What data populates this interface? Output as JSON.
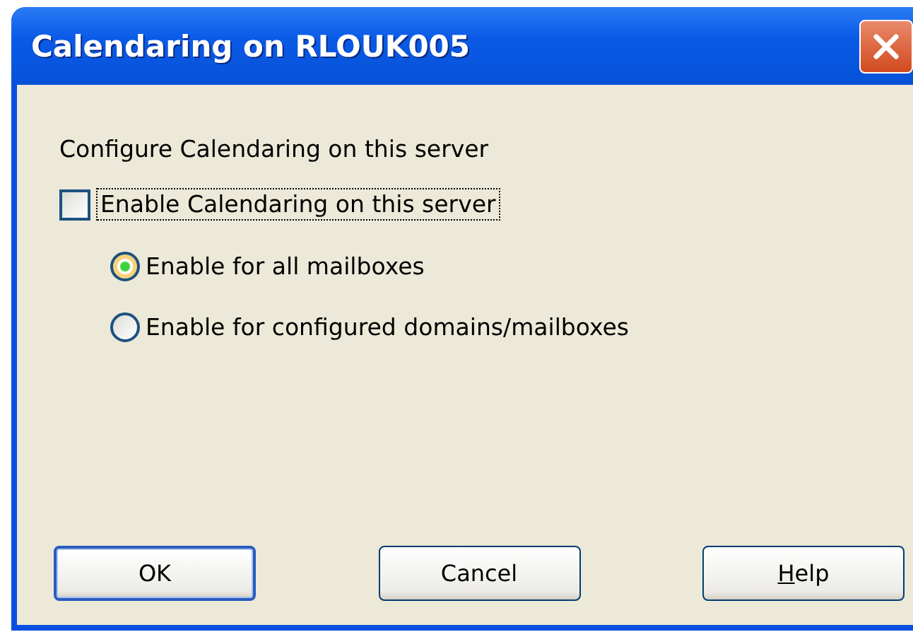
{
  "window": {
    "title": "Calendaring on RLOUK005"
  },
  "heading": "Configure Calendaring on this server",
  "checkbox": {
    "label": "Enable Calendaring on this server",
    "checked": false,
    "focused": true
  },
  "radios": [
    {
      "label": "Enable for all mailboxes",
      "selected": true
    },
    {
      "label": "Enable for configured domains/mailboxes",
      "selected": false
    }
  ],
  "buttons": [
    {
      "label": "OK",
      "default": true,
      "access_key_underlined": false
    },
    {
      "label": "Cancel",
      "default": false,
      "access_key_underlined": false
    },
    {
      "label": "Help",
      "default": false,
      "access_key_underlined": true
    }
  ]
}
